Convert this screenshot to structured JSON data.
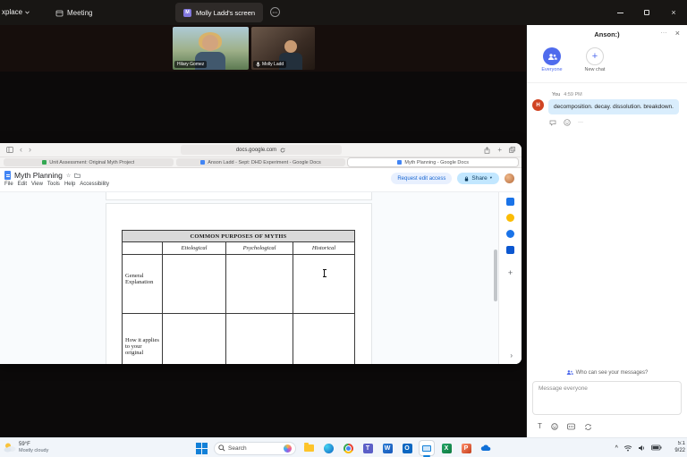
{
  "titlebar": {
    "workspace_label": "xplace",
    "meeting_tab_label": "Meeting",
    "screen_tab_label": "Molly Ladd's screen",
    "screen_tab_avatar_initial": "M"
  },
  "stage": {
    "participants": [
      {
        "name": "Hilary Gomez"
      },
      {
        "name": "Molly Ladd"
      }
    ]
  },
  "browser": {
    "address": "docs.google.com",
    "tabs": [
      {
        "title": "Unit Assessment: Original Myth Project"
      },
      {
        "title": "Anson Ladd - Sept: DHD Experiment - Google Docs"
      },
      {
        "title": "Myth Planning - Google Docs"
      }
    ],
    "docs": {
      "doc_title": "Myth Planning",
      "menu_items": [
        "File",
        "Edit",
        "View",
        "Tools",
        "Help",
        "Accessibility"
      ],
      "request_edit_label": "Request edit access",
      "share_label": "Share"
    }
  },
  "document_table": {
    "title": "COMMON PURPOSES OF MYTHS",
    "columns": [
      "Etiological",
      "Psychological",
      "Historical"
    ],
    "rows": [
      {
        "label": "General Explanation"
      },
      {
        "label": "How it applies to your original"
      }
    ]
  },
  "chat": {
    "title": "Anson:)",
    "channels": [
      {
        "label": "Everyone"
      },
      {
        "label": "New chat"
      }
    ],
    "message": {
      "sender": "You",
      "time": "4:59 PM",
      "avatar_initial": "H",
      "text": "decomposition. decay. dissolution. breakdown."
    },
    "privacy_note": "Who can see your messages?",
    "compose_placeholder": "Message everyone"
  },
  "taskbar": {
    "weather_temp": "59°F",
    "weather_condition": "Mostly cloudy",
    "search_label": "Search",
    "clock_time": "5:1",
    "clock_date": "9/22"
  }
}
